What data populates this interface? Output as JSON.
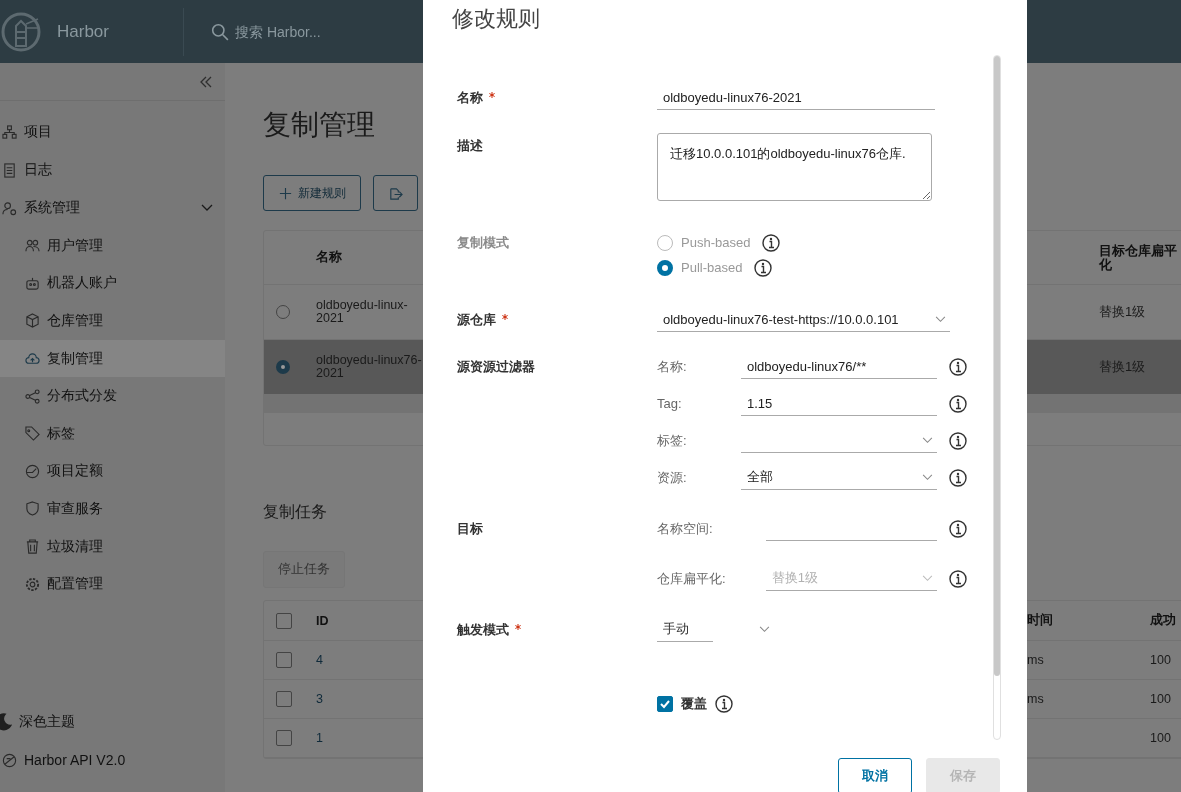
{
  "header": {
    "brand": "Harbor",
    "search_placeholder": "搜索 Harbor..."
  },
  "sidebar": {
    "items": [
      {
        "label": "项目"
      },
      {
        "label": "日志"
      },
      {
        "label": "系统管理",
        "expanded": true,
        "children": [
          {
            "label": "用户管理",
            "selected": false
          },
          {
            "label": "机器人账户",
            "selected": false
          },
          {
            "label": "仓库管理",
            "selected": false
          },
          {
            "label": "复制管理",
            "selected": true
          },
          {
            "label": "分布式分发",
            "selected": false
          },
          {
            "label": "标签",
            "selected": false
          },
          {
            "label": "项目定额",
            "selected": false
          },
          {
            "label": "审查服务",
            "selected": false
          },
          {
            "label": "垃圾清理",
            "selected": false
          },
          {
            "label": "配置管理",
            "selected": false
          }
        ]
      }
    ],
    "footer": [
      {
        "label": "深色主题"
      },
      {
        "label": "Harbor API V2.0"
      }
    ]
  },
  "page": {
    "title": "复制管理",
    "actions": [
      {
        "kind": "new",
        "label": "新建规则"
      },
      {
        "kind": "export"
      }
    ]
  },
  "rules_table": {
    "columns": [
      "名称",
      "目标仓库扁平化"
    ],
    "rows": [
      {
        "name": "oldboyedu-linux-2021",
        "flattening": "替换1级",
        "selected": false
      },
      {
        "name": "oldboyedu-linux76-2021",
        "flattening": "替换1级",
        "selected": true
      }
    ]
  },
  "tasks": {
    "title": "复制任务",
    "stop_button": {
      "label": "停止任务",
      "disabled": true
    },
    "all_checked": false,
    "columns": [
      "ID",
      "时间",
      "成功"
    ],
    "rows": [
      {
        "id": "4",
        "time": "ms",
        "success": "100",
        "checked": false
      },
      {
        "id": "3",
        "time": "ms",
        "success": "100",
        "checked": false
      },
      {
        "id": "1",
        "success": "100",
        "checked": false
      }
    ]
  },
  "dialog": {
    "title": "修改规则",
    "fields": [
      {
        "kind": "text",
        "label": "名称",
        "required": true,
        "value": "oldboyedu-linux76-2021"
      },
      {
        "kind": "textarea",
        "label": "描述",
        "required": false,
        "value": "迁移10.0.0.101的oldboyedu-linux76仓库."
      },
      {
        "kind": "radio",
        "label": "复制模式",
        "required": false,
        "disabled": true,
        "options": [
          {
            "label": "Push-based",
            "selected": false
          },
          {
            "label": "Pull-based",
            "selected": true
          }
        ]
      },
      {
        "kind": "select",
        "label": "源仓库",
        "required": true,
        "value": "oldboyedu-linux76-test-https://10.0.0.101"
      },
      {
        "kind": "group",
        "label": "源资源过滤器",
        "required": false,
        "subfields": [
          {
            "kind": "text",
            "label": "名称:",
            "value": "oldboyedu-linux76/**"
          },
          {
            "kind": "text",
            "label": "Tag:",
            "value": "1.15"
          },
          {
            "kind": "select",
            "label": "标签:"
          },
          {
            "kind": "select",
            "label": "资源:",
            "value": "全部"
          }
        ]
      },
      {
        "kind": "group",
        "label": "目标",
        "required": false,
        "subfields": [
          {
            "kind": "text",
            "label": "名称空间:"
          },
          {
            "kind": "select",
            "label": "仓库扁平化:",
            "disabled": true,
            "value": "替换1级"
          }
        ]
      },
      {
        "kind": "inline-select",
        "label": "触发模式",
        "required": true,
        "value": "手动"
      },
      {
        "kind": "checkbox",
        "label": "覆盖",
        "required": false,
        "checked": true
      }
    ],
    "buttons": [
      {
        "label": "取消",
        "kind": "secondary",
        "disabled": false
      },
      {
        "label": "保存",
        "kind": "primary",
        "disabled": true
      }
    ]
  }
}
